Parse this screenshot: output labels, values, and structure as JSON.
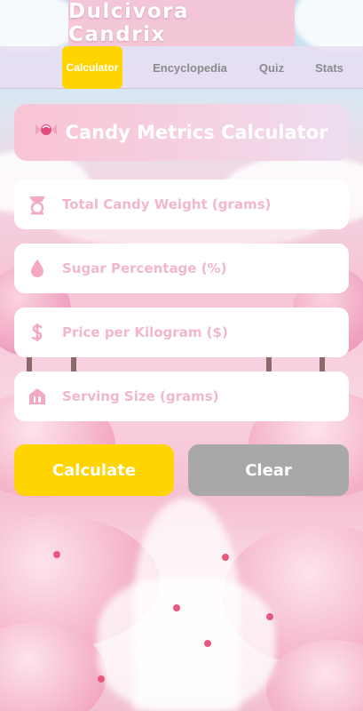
{
  "app": {
    "title": "Dulcivora Candrix"
  },
  "nav": {
    "tabs": [
      {
        "label": "Calculator",
        "active": true
      },
      {
        "label": "Encyclopedia",
        "active": false
      },
      {
        "label": "Quiz",
        "active": false
      },
      {
        "label": "Stats",
        "active": false
      }
    ]
  },
  "calculator": {
    "heading_icon": "candy-icon",
    "heading": "Candy Metrics Calculator",
    "fields": [
      {
        "icon": "scale-icon",
        "placeholder": "Total Candy Weight (grams)",
        "value": ""
      },
      {
        "icon": "droplet-icon",
        "placeholder": "Sugar Percentage (%)",
        "value": ""
      },
      {
        "icon": "dollar-icon",
        "placeholder": "Price per Kilogram ($)",
        "value": ""
      },
      {
        "icon": "serving-icon",
        "placeholder": "Serving Size (grams)",
        "value": ""
      }
    ],
    "calculate_label": "Calculate",
    "clear_label": "Clear"
  },
  "colors": {
    "accent": "#ffd400",
    "pink": "#f3b7cb",
    "icon_pink": "#f3a9c4",
    "clear_gray": "#a8a8a8"
  }
}
